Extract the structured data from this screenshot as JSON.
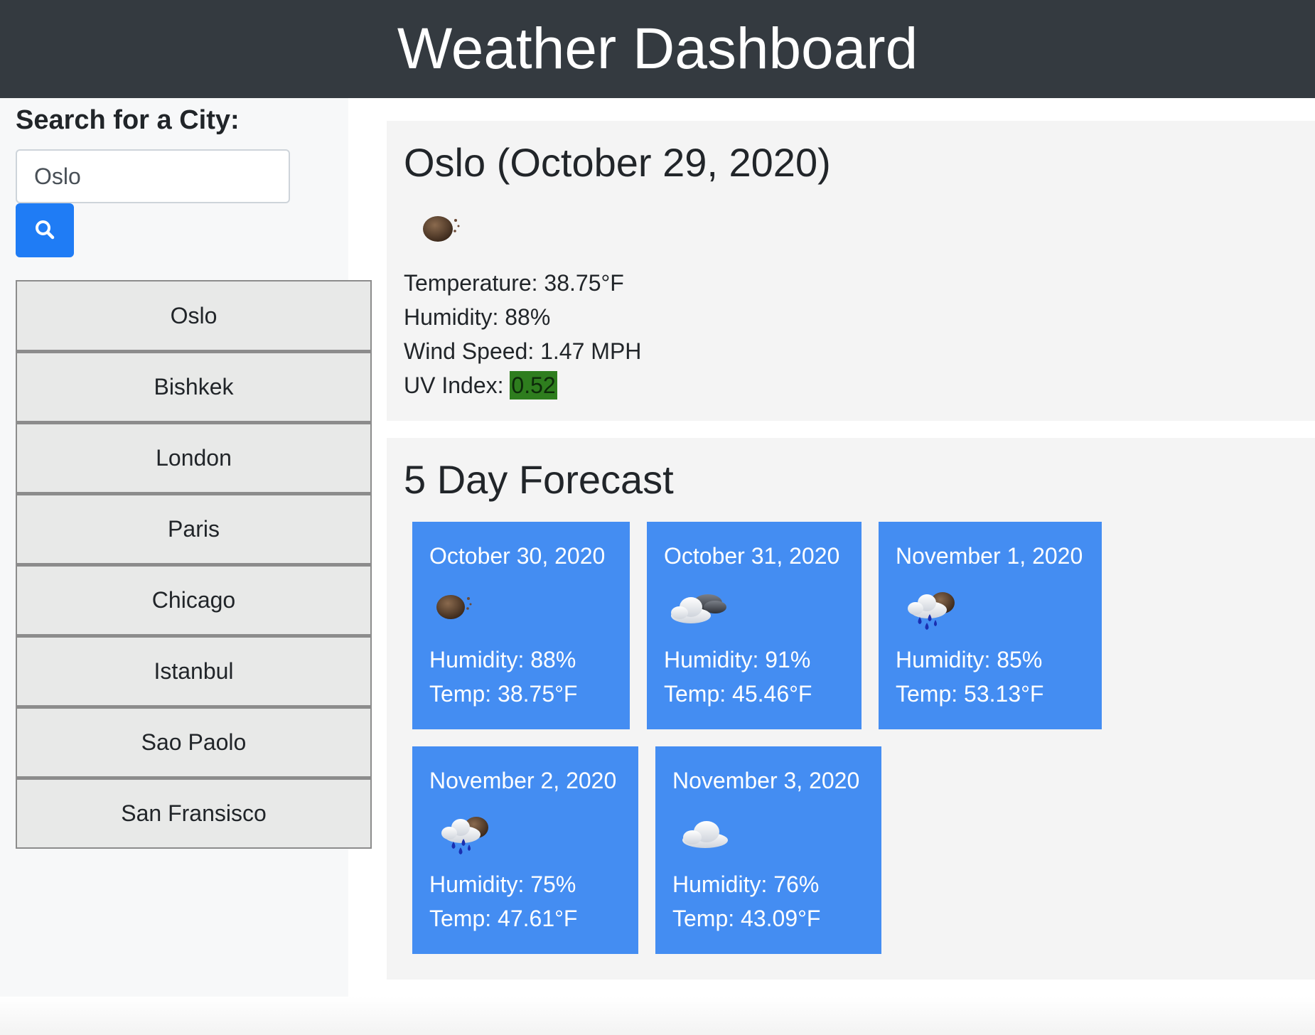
{
  "header": {
    "title": "Weather Dashboard"
  },
  "sidebar": {
    "search_label": "Search for a City:",
    "search_value": "Oslo",
    "search_icon": "search-icon",
    "history": [
      "Oslo",
      "Bishkek",
      "London",
      "Paris",
      "Chicago",
      "Istanbul",
      "Sao Paolo",
      "San Fransisco"
    ]
  },
  "current": {
    "title": "Oslo (October 29, 2020)",
    "icon": "night-clear-moon-icon",
    "temperature_label": "Temperature: 38.75°F",
    "humidity_label": "Humidity: 88%",
    "wind_label": "Wind Speed: 1.47 MPH",
    "uv_label": "UV Index:",
    "uv_value": "0.52",
    "uv_color": "#2e7d1e"
  },
  "forecast": {
    "title": "5 Day Forecast",
    "card_color": "#448df2",
    "days": [
      {
        "date": "October 30, 2020",
        "icon": "night-clear-moon-icon",
        "humidity": "Humidity: 88%",
        "temp": "Temp: 38.75°F"
      },
      {
        "date": "October 31, 2020",
        "icon": "night-broken-clouds-icon",
        "humidity": "Humidity: 91%",
        "temp": "Temp: 45.46°F"
      },
      {
        "date": "November 1, 2020",
        "icon": "night-rain-icon",
        "humidity": "Humidity: 85%",
        "temp": "Temp: 53.13°F"
      },
      {
        "date": "November 2, 2020",
        "icon": "night-rain-icon",
        "humidity": "Humidity: 75%",
        "temp": "Temp: 47.61°F"
      },
      {
        "date": "November 3, 2020",
        "icon": "cloud-icon",
        "humidity": "Humidity: 76%",
        "temp": "Temp: 43.09°F"
      }
    ]
  }
}
